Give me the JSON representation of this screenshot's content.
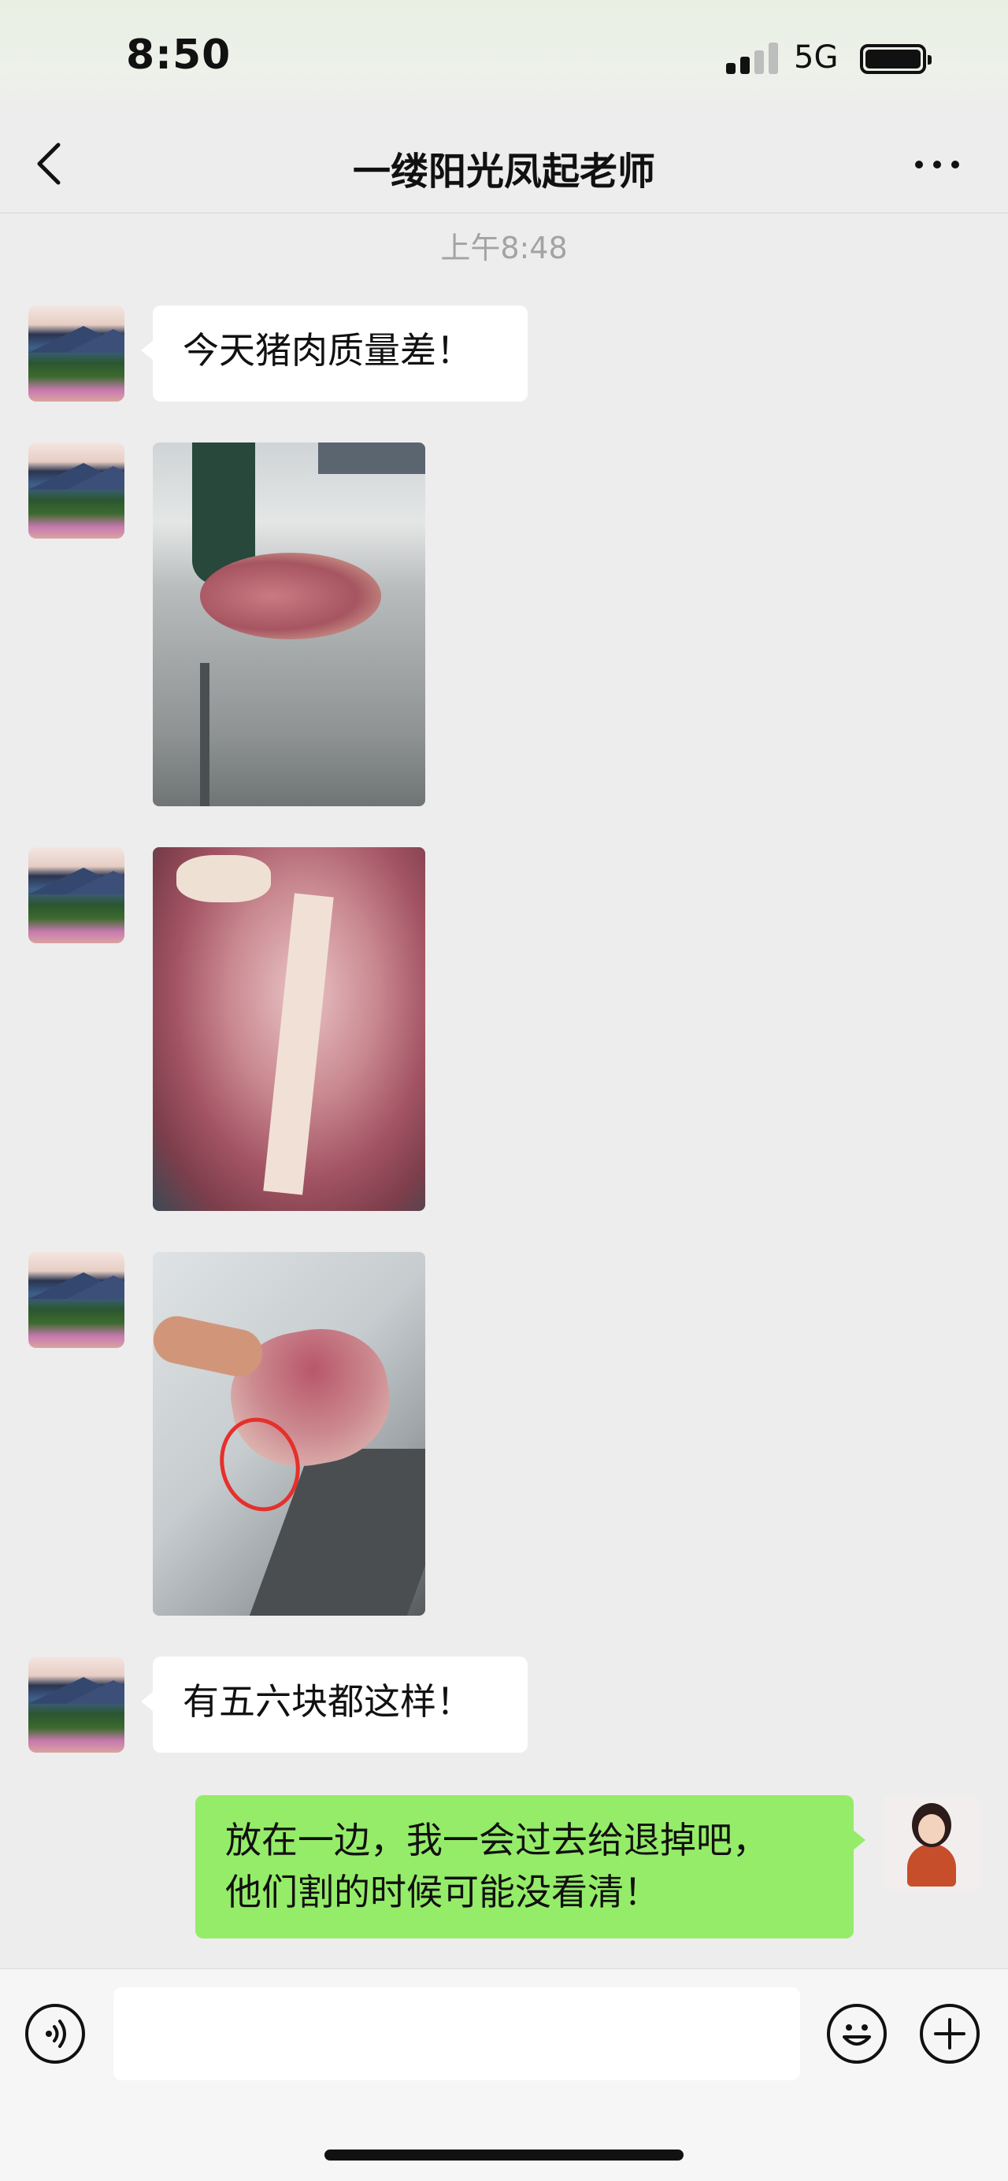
{
  "status_bar": {
    "time": "8:50",
    "network": "5G",
    "signal_bars": 2,
    "battery_level": 1.0
  },
  "nav": {
    "title": "一缕阳光凤起老师",
    "back_icon": "chevron-left-icon",
    "more_icon": "more-dots-icon"
  },
  "chat": {
    "timestamp": "上午8:48",
    "messages": [
      {
        "type": "text",
        "side": "left",
        "text": "今天猪肉质量差！"
      },
      {
        "type": "image",
        "side": "left"
      },
      {
        "type": "image",
        "side": "left"
      },
      {
        "type": "image",
        "side": "left"
      },
      {
        "type": "text",
        "side": "left",
        "text": "有五六块都这样！"
      },
      {
        "type": "text",
        "side": "right",
        "text": "放在一边，我一会过去给退掉吧，\n他们割的时候可能没看清！"
      }
    ]
  },
  "input_bar": {
    "value": "",
    "voice_icon": "voice-icon",
    "emoji_icon": "emoji-icon",
    "plus_icon": "plus-icon"
  },
  "colors": {
    "background": "#ededed",
    "my_bubble": "#95ec69",
    "their_bubble": "#ffffff"
  }
}
